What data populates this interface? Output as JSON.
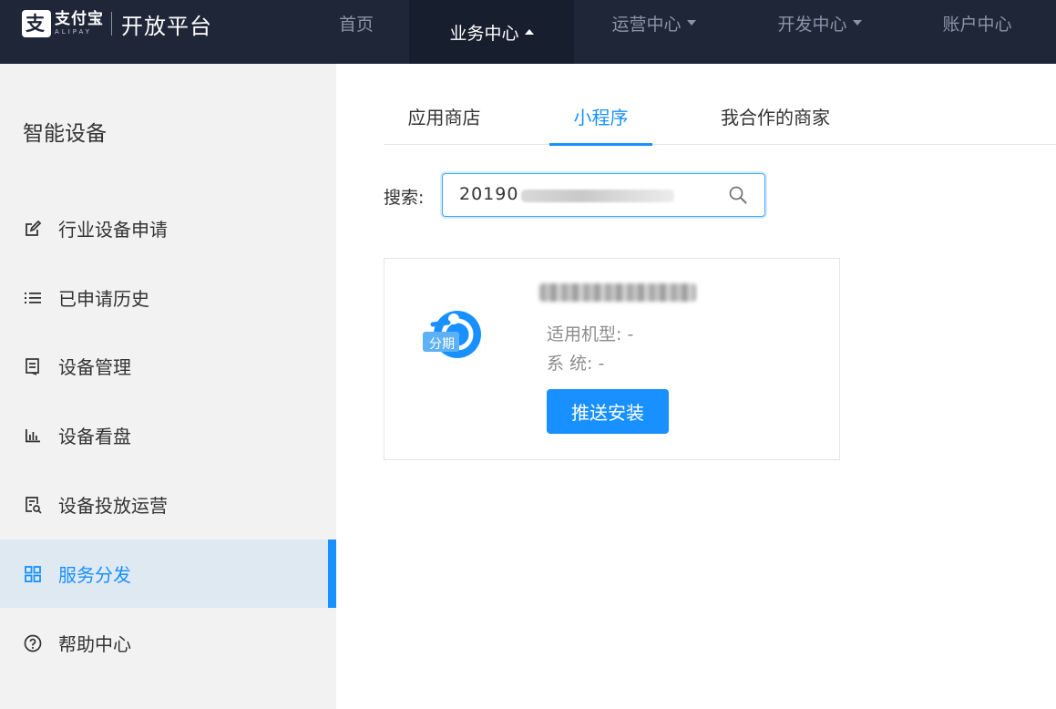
{
  "brand": {
    "name_cn": "支付宝",
    "name_en": "ALIPAY",
    "title": "开放平台"
  },
  "topnav": {
    "items": [
      {
        "label": "首页",
        "dropdown": false,
        "active": false
      },
      {
        "label": "业务中心",
        "dropdown": true,
        "active": true
      },
      {
        "label": "运营中心",
        "dropdown": true,
        "active": false
      },
      {
        "label": "开发中心",
        "dropdown": true,
        "active": false
      },
      {
        "label": "账户中心",
        "dropdown": false,
        "active": false
      }
    ]
  },
  "sidebar": {
    "title": "智能设备",
    "items": [
      {
        "label": "行业设备申请",
        "icon": "edit-icon",
        "active": false
      },
      {
        "label": "已申请历史",
        "icon": "list-icon",
        "active": false
      },
      {
        "label": "设备管理",
        "icon": "device-doc-icon",
        "active": false
      },
      {
        "label": "设备看盘",
        "icon": "bar-chart-icon",
        "active": false
      },
      {
        "label": "设备投放运营",
        "icon": "doc-search-icon",
        "active": false
      },
      {
        "label": "服务分发",
        "icon": "grid-icon",
        "active": true
      },
      {
        "label": "帮助中心",
        "icon": "question-circle-icon",
        "active": false
      }
    ]
  },
  "tabs": [
    {
      "label": "应用商店",
      "active": false
    },
    {
      "label": "小程序",
      "active": true
    },
    {
      "label": "我合作的商家",
      "active": false
    }
  ],
  "search": {
    "label": "搜索:",
    "value": "20190",
    "icon": "search-icon"
  },
  "card": {
    "app_icon_text": "分期",
    "model_label": "适用机型:",
    "model_value": "-",
    "system_label": "系 统:",
    "system_value": "-",
    "button_label": "推送安装"
  },
  "colors": {
    "topbar": "#1e2638",
    "accent": "#1890ff",
    "sidebar_bg": "#f2f2f2",
    "sidebar_active_bg": "#dfe9f2"
  }
}
